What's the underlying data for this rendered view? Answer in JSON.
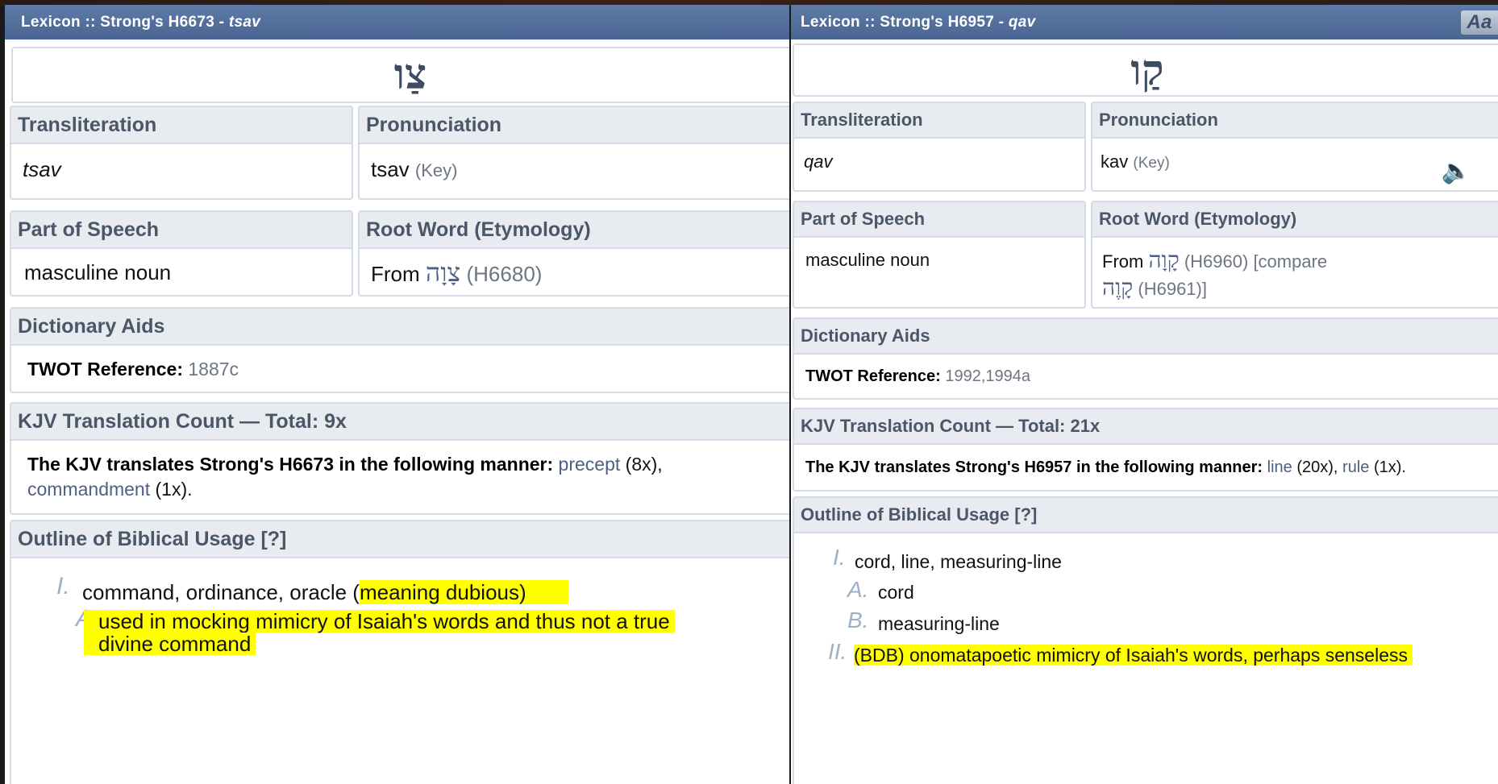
{
  "left": {
    "title_prefix": "Lexicon :: Strong's H6673 - ",
    "title_word": "tsav",
    "lemma": "צַו",
    "translit_label": "Transliteration",
    "translit": "tsav",
    "pron_label": "Pronunciation",
    "pron": "tsav",
    "pron_key": "(Key)",
    "pos_label": "Part of Speech",
    "pos": "masculine noun",
    "root_label": "Root Word (Etymology)",
    "root_from": "From",
    "root_heb": "צָוָה",
    "root_ref": "(H6680)",
    "dict_label": "Dictionary Aids",
    "twot_label": "TWOT Reference:",
    "twot_value": "1887c",
    "kjv_label": "KJV Translation Count — Total: 9x",
    "kjv_lead": "The KJV translates Strong's H6673 in the following manner:",
    "kjv_w1": "precept",
    "kjv_c1": "(8x),",
    "kjv_w2": "commandment",
    "kjv_c2": "(1x).",
    "outline_label": "Outline of Biblical Usage [?]",
    "o1_num": "I.",
    "o1_text": "command, ordinance, oracle (",
    "o1_hl": "meaning dubious)",
    "o1a_num": "A.",
    "o1a_text1": "used in mocking mimicry of Isaiah's words and thus not a true",
    "o1a_text2": "divine command"
  },
  "right": {
    "title_prefix": "Lexicon :: Strong's H6957 - ",
    "title_word": "qav",
    "aa_label": "Aa",
    "lemma": "קַו",
    "translit_label": "Transliteration",
    "translit": "qav",
    "pron_label": "Pronunciation",
    "pron": "kav",
    "pron_key": "(Key)",
    "pos_label": "Part of Speech",
    "pos": "masculine noun",
    "root_label": "Root Word (Etymology)",
    "root_from": "From",
    "root_heb": "קָוָה",
    "root_ref": "(H6960) [compare",
    "root_heb2": "קָוֶה",
    "root_ref2": "(H6961)]",
    "dict_label": "Dictionary Aids",
    "twot_label": "TWOT Reference:",
    "twot_value": "1992,1994a",
    "kjv_label": "KJV Translation Count — Total: 21x",
    "kjv_lead": "The KJV translates Strong's H6957 in the following manner:",
    "kjv_w1": "line",
    "kjv_c1": "(20x),",
    "kjv_w2": "rule",
    "kjv_c2": "(1x).",
    "outline_label": "Outline of Biblical Usage [?]",
    "o1_num": "I.",
    "o1_text": "cord, line, measuring-line",
    "o1a_num": "A.",
    "o1a_text": "cord",
    "o1b_num": "B.",
    "o1b_text": "measuring-line",
    "o2_num": "II.",
    "o2_text": "(BDB) onomatapoetic mimicry of Isaiah's words, perhaps senseless"
  }
}
